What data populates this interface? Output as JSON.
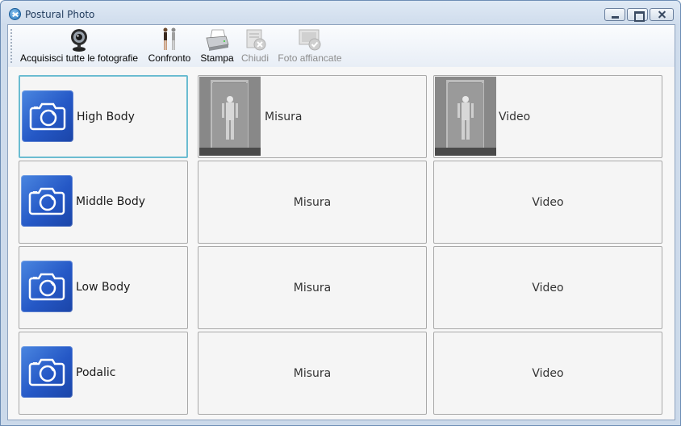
{
  "window": {
    "title": "Postural Photo"
  },
  "toolbar": {
    "items": [
      {
        "label": "Acquisisci tutte le fotografie",
        "icon": "webcam-icon",
        "enabled": true
      },
      {
        "label": "Confronto",
        "icon": "compare-figures-icon",
        "enabled": true
      },
      {
        "label": "Stampa",
        "icon": "printer-icon",
        "enabled": true
      },
      {
        "label": "Chiudi",
        "icon": "close-document-icon",
        "enabled": false
      },
      {
        "label": "Foto affiancate",
        "icon": "side-by-side-icon",
        "enabled": false
      }
    ]
  },
  "rows": [
    {
      "label": "High Body",
      "misura": "Misura",
      "video": "Video",
      "has_thumbnails": true,
      "selected": true
    },
    {
      "label": "Middle Body",
      "misura": "Misura",
      "video": "Video",
      "has_thumbnails": false,
      "selected": false
    },
    {
      "label": "Low Body",
      "misura": "Misura",
      "video": "Video",
      "has_thumbnails": false,
      "selected": false
    },
    {
      "label": "Podalic",
      "misura": "Misura",
      "video": "Video",
      "has_thumbnails": false,
      "selected": false
    }
  ],
  "colors": {
    "camera_tile": "#2a5fcc",
    "selected_border": "#6bbcd1"
  }
}
